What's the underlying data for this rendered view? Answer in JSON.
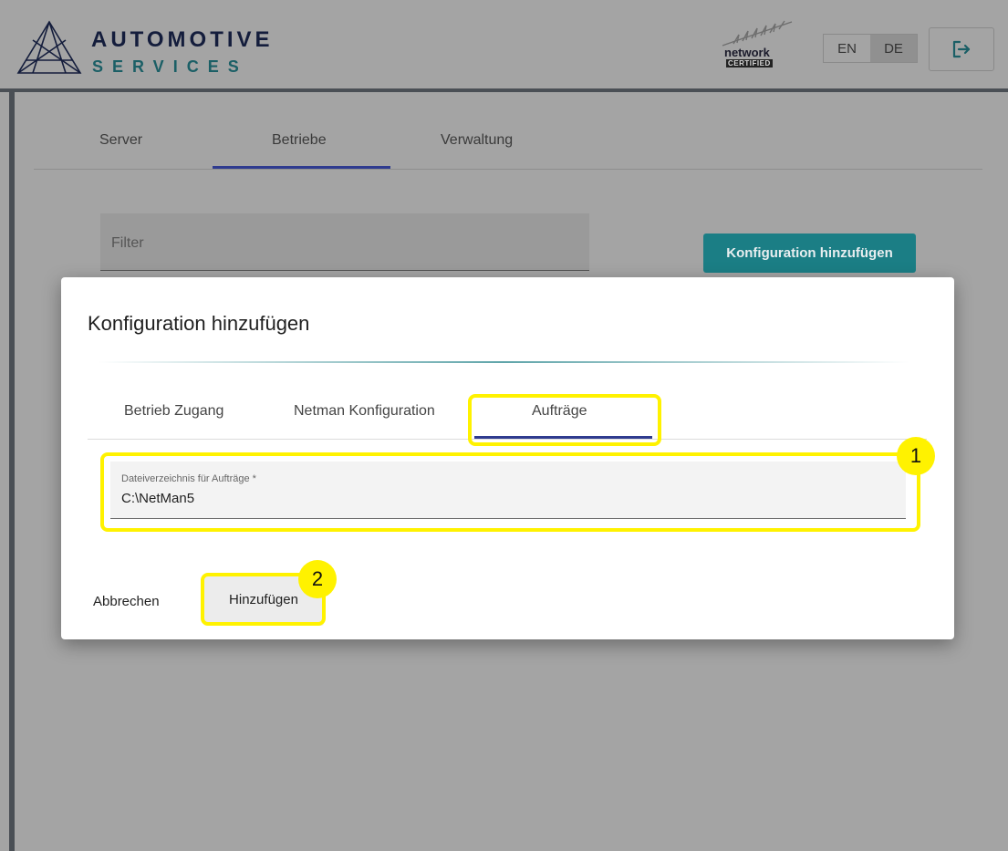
{
  "header": {
    "brand_top": "AUTOMOTIVE",
    "brand_bottom": "SERVICES",
    "badge_word": "network",
    "badge_cert": "CERTIFIED",
    "lang_en": "EN",
    "lang_de": "DE",
    "lang_selected": "DE"
  },
  "page_tabs": [
    {
      "label": "Server"
    },
    {
      "label": "Betriebe",
      "active": true
    },
    {
      "label": "Verwaltung"
    }
  ],
  "filter": {
    "placeholder": "Filter"
  },
  "add_button": {
    "label": "Konfiguration hinzufügen"
  },
  "dialog": {
    "title": "Konfiguration hinzufügen",
    "tabs": [
      {
        "label": "Betrieb Zugang"
      },
      {
        "label": "Netman Konfiguration"
      },
      {
        "label": "Aufträge",
        "active": true
      }
    ],
    "field": {
      "label": "Dateiverzeichnis für Aufträge *",
      "value": "C:\\NetMan5"
    },
    "cancel_label": "Abbrechen",
    "submit_label": "Hinzufügen"
  },
  "annotations": {
    "marker_1": "1",
    "marker_2": "2"
  },
  "colors": {
    "accent": "#1b7e85",
    "tab_ink": "#2f3b8f",
    "highlight": "#fff200",
    "navy": "#141d3c"
  },
  "icons": {
    "logo": "triangle-logo-icon",
    "badge": "wheat-certified-icon",
    "logout": "logout-icon"
  }
}
